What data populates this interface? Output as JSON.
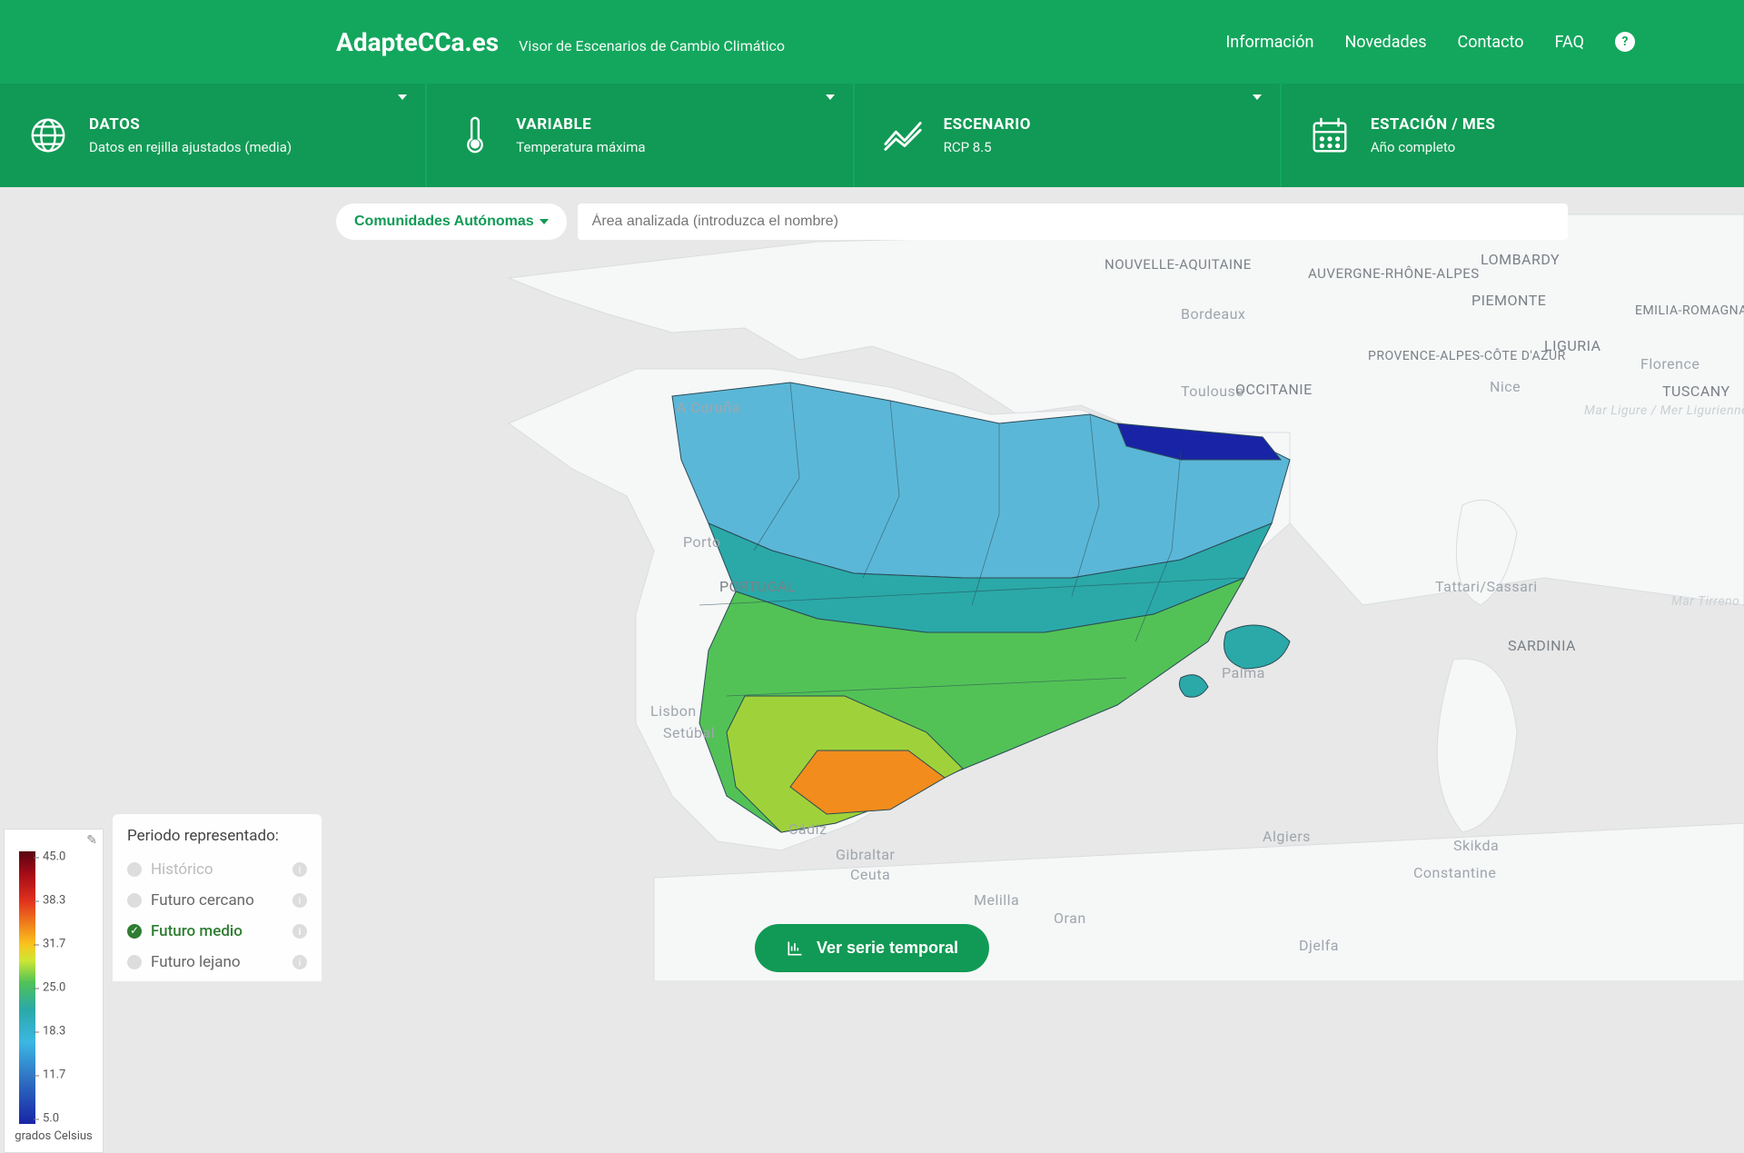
{
  "header": {
    "brand": "AdapteCCa.es",
    "subtitle": "Visor de Escenarios de Cambio Climático",
    "nav": [
      "Información",
      "Novedades",
      "Contacto",
      "FAQ"
    ]
  },
  "filters": {
    "datos": {
      "title": "DATOS",
      "sub": "Datos en rejilla ajustados (media)"
    },
    "variable": {
      "title": "VARIABLE",
      "sub": "Temperatura máxima"
    },
    "escenario": {
      "title": "ESCENARIO",
      "sub": "RCP 8.5"
    },
    "estacion": {
      "title": "ESTACIÓN / MES",
      "sub": "Año completo"
    }
  },
  "search": {
    "region_button": "Comunidades Autónomas",
    "placeholder": "Área analizada (introduzca el nombre)"
  },
  "legend": {
    "ticks": [
      "45.0",
      "38.3",
      "31.7",
      "25.0",
      "18.3",
      "11.7",
      "5.0"
    ],
    "unit": "grados Celsius"
  },
  "period_panel": {
    "title": "Periodo representado:",
    "options": [
      {
        "label": "Histórico",
        "state": "disabled"
      },
      {
        "label": "Futuro cercano",
        "state": "off"
      },
      {
        "label": "Futuro medio",
        "state": "on"
      },
      {
        "label": "Futuro lejano",
        "state": "off"
      }
    ]
  },
  "map_labels": {
    "city_coruna": "A Coruña",
    "city_porto": "Porto",
    "city_lisbon": "Lisbon",
    "city_setubal": "Setúbal",
    "city_cadiz": "Cádiz",
    "city_gibraltar": "Gibraltar",
    "city_ceuta": "Ceuta",
    "city_melilla": "Melilla",
    "city_bordeaux": "Bordeaux",
    "city_toulouse": "Toulouse",
    "city_nice": "Nice",
    "city_florence": "Florence",
    "city_palma": "Palma",
    "city_tattari": "Tattari/Sassari",
    "city_algiers": "Algiers",
    "city_constantine": "Constantine",
    "city_skikda": "Skikda",
    "city_djelfa": "Djelfa",
    "city_oran": "Oran",
    "country_portugal": "PORTUGAL",
    "region_nouvelle": "NOUVELLE-AQUITAINE",
    "region_auvergne": "AUVERGNE-RHÔNE-ALPES",
    "region_lombardy": "LOMBARDY",
    "region_piemonte": "PIEMONTE",
    "region_emilia": "EMILIA-ROMAGNA",
    "region_liguria": "LIGURIA",
    "region_tuscany": "TUSCANY",
    "region_sardinia": "SARDINIA",
    "region_occitanie": "OCCITANIE",
    "region_provence": "PROVENCE-ALPES-CÔTE D'AZUR",
    "sea_ligure": "Mar Ligure / Mer Ligurienne",
    "sea_tirreno": "Mar Tirreno / Mer Tyrrhén"
  },
  "buttons": {
    "timeseries": "Ver serie temporal"
  },
  "colors": {
    "brand_green": "#13a75d",
    "filter_green": "#119a55"
  }
}
